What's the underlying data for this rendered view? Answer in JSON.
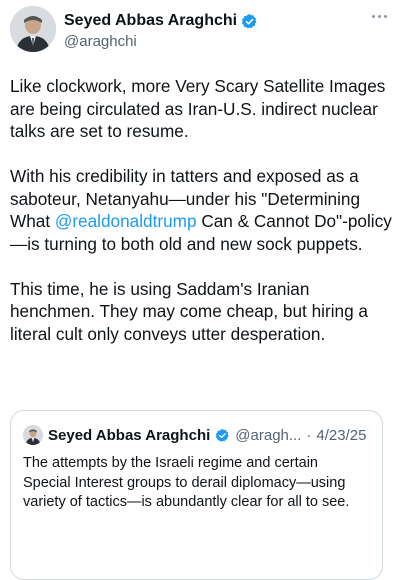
{
  "author": {
    "display_name": "Seyed Abbas Araghchi",
    "handle": "@araghchi"
  },
  "body": {
    "p1": "Like clockwork, more Very Scary Satellite Images are being circulated as Iran-U.S. indirect nuclear talks are set to resume.",
    "p2_before": "With his credibility in tatters and exposed as a saboteur, Netanyahu—under his \"Determining What ",
    "p2_mention": "@realdonaldtrump",
    "p2_after": " Can & Cannot Do\"-policy—is turning to both old and new sock puppets.",
    "p3": "This time, he is using Saddam's Iranian henchmen. They may come cheap, but hiring a literal cult only conveys utter desperation."
  },
  "quote": {
    "display_name": "Seyed Abbas Araghchi",
    "handle": "@aragh...",
    "separator": "·",
    "date": "4/23/25",
    "text": "The attempts by the Israeli regime and certain Special Interest groups to derail diplomacy—using variety of tactics—is abundantly clear for all to see."
  },
  "colors": {
    "verified_badge": "#1d9bf0",
    "mention": "#1d9bf0",
    "secondary_text": "#536471"
  },
  "icons": {
    "verified": "verified-badge-icon",
    "more": "more-options-icon"
  }
}
